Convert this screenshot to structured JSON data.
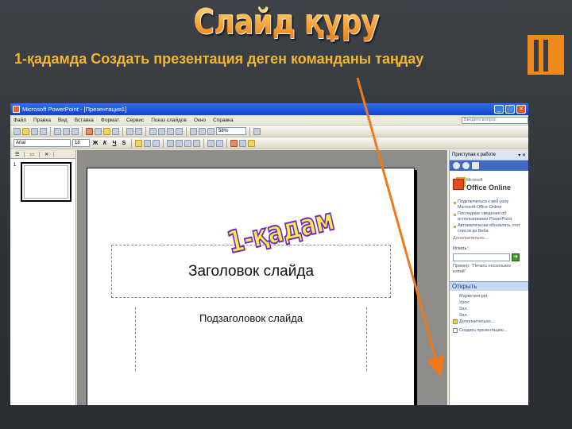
{
  "slide_title": "Слайд құру",
  "subtitle": "1-қадамда Создать презентация деген команданы таңдау",
  "window": {
    "title": "Microsoft PowerPoint - [Презентация1]",
    "buttons": [
      "_",
      "□",
      "✕"
    ],
    "menu": [
      "Файл",
      "Правка",
      "Вид",
      "Вставка",
      "Формат",
      "Сервис",
      "Показ слайдов",
      "Окно",
      "Справка"
    ],
    "help_placeholder": "Введите вопрос",
    "zoom": "58%",
    "font_name": "Arial",
    "font_size": "18"
  },
  "slide_pane": {
    "tabs": [
      "☰",
      "▭",
      "✕"
    ],
    "thumbnail_number": "1"
  },
  "slide": {
    "title_placeholder": "Заголовок слайда",
    "subtitle_placeholder": "Подзаголовок слайда"
  },
  "stamp_text": "1-қадам",
  "task_pane": {
    "header": "Приступая к работе",
    "close": "▾ ✕",
    "logo_word1": "Microsoft",
    "logo_word2": "Office Online",
    "links": [
      "Подключиться к веб-узлу Microsoft Office Online",
      "Последние сведения об использовании PowerPoint",
      "Автоматически обновлять этот список из Веба"
    ],
    "more": "Дополнительно...",
    "search_label": "Искать:",
    "search_go": "➜",
    "example": "Пример: \"Печать нескольких копий\"",
    "open_section": "Открыть",
    "open_items": [
      "Маркетинг.ppt",
      "Урок",
      "Зал",
      "Зал"
    ],
    "more_open": "Дополнительно...",
    "create_new": "Создать презентацию..."
  },
  "colors": {
    "accent_orange": "#f7a72f",
    "arrow": "#f07a1a",
    "stamp_fill": "#ffea4a",
    "stamp_outline": "#6a2dbf"
  }
}
